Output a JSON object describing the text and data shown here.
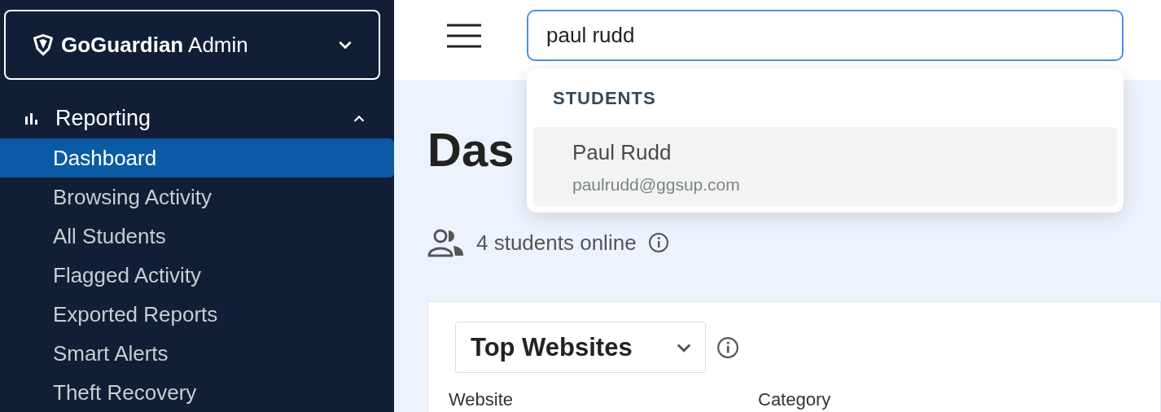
{
  "brand": {
    "name": "GoGuardian",
    "suffix": "Admin"
  },
  "sidebar": {
    "section": {
      "label": "Reporting",
      "expanded": true
    },
    "items": [
      {
        "label": "Dashboard",
        "selected": true
      },
      {
        "label": "Browsing Activity",
        "selected": false
      },
      {
        "label": "All Students",
        "selected": false
      },
      {
        "label": "Flagged Activity",
        "selected": false
      },
      {
        "label": "Exported Reports",
        "selected": false
      },
      {
        "label": "Smart Alerts",
        "selected": false
      },
      {
        "label": "Theft Recovery",
        "selected": false
      }
    ]
  },
  "search": {
    "value": "paul rudd"
  },
  "search_results": {
    "heading": "STUDENTS",
    "items": [
      {
        "name": "Paul Rudd",
        "email": "paulrudd@ggsup.com",
        "selected": true
      }
    ]
  },
  "page_title": "Das",
  "online": "4 students online",
  "card": {
    "select": "Top Websites",
    "columns": [
      "Website",
      "Category"
    ]
  }
}
